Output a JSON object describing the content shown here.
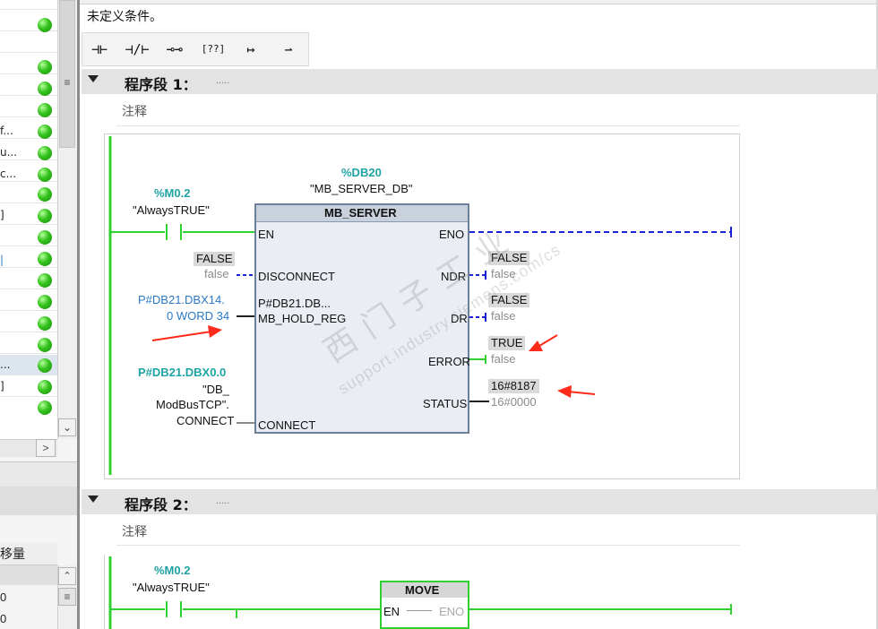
{
  "left_panel": {
    "fragments": [
      "f...",
      "u...",
      "c...",
      "]",
      "|",
      "...",
      "]"
    ],
    "column_header": "移量",
    "values": [
      "0",
      "0"
    ]
  },
  "editor": {
    "condition_text": "未定义条件。",
    "toolbar": [
      "⊣⊢",
      "⊣/⊢",
      "⊸⊸",
      "[??]",
      "↦",
      "⇀"
    ]
  },
  "network1": {
    "title": "程序段 1：",
    "dots": ".....",
    "comment": "注释",
    "contact": {
      "address": "%M0.2",
      "symbol": "\"AlwaysTRUE\""
    },
    "instance": {
      "address": "%DB20",
      "name": "\"MB_SERVER_DB\""
    },
    "block": {
      "name": "MB_SERVER",
      "inputs": {
        "en": "EN",
        "disconnect": "DISCONNECT",
        "hold_reg_inner": "P#DB21.DB...",
        "mb_hold_reg": "MB_HOLD_REG",
        "connect": "CONNECT"
      },
      "outputs": {
        "eno": "ENO",
        "ndr": "NDR",
        "dr": "DR",
        "error": "ERROR",
        "status": "STATUS"
      }
    },
    "disconnect_value": "FALSE",
    "disconnect_live": "false",
    "hold_reg_param_line1": "P#DB21.DBX14.",
    "hold_reg_param_line2": "0 WORD 34",
    "connect_param": {
      "address": "P#DB21.DBX0.0",
      "line1": "\"DB_",
      "line2": "ModBusTCP\".",
      "line3": "CONNECT"
    },
    "ndr_value": "FALSE",
    "ndr_live": "false",
    "dr_value": "FALSE",
    "dr_live": "false",
    "error_value": "TRUE",
    "error_live": "false",
    "status_value": "16#8187",
    "status_live": "16#0000"
  },
  "network2": {
    "title": "程序段 2：",
    "dots": ".....",
    "comment": "注释",
    "contact": {
      "address": "%M0.2",
      "symbol": "\"AlwaysTRUE\""
    },
    "block": {
      "name": "MOVE",
      "en": "EN",
      "eno": "ENO"
    }
  },
  "watermark": {
    "line1": "西门子工业",
    "line2": "support.industry.siemens.com/cs"
  },
  "colors": {
    "power_flow": "#2fd02f",
    "dashed_signal": "#1a22d6",
    "annotation_arrow": "#ff2a1a",
    "block_border": "#6b7f98",
    "network_header": "#e3e3e3"
  }
}
